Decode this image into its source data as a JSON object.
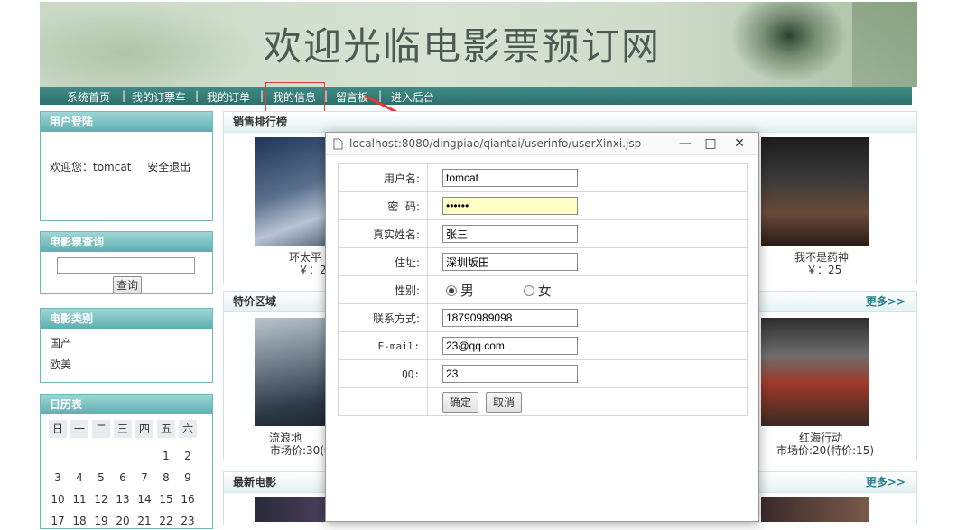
{
  "banner": {
    "title": "欢迎光临电影票预订网"
  },
  "nav": {
    "items": [
      "系统首页",
      "我的订票车",
      "我的订单",
      "我的信息",
      "留言板",
      "进入后台"
    ]
  },
  "login_panel": {
    "title": "用户登陆",
    "welcome": "欢迎您：tomcat",
    "logout": "安全退出"
  },
  "search_panel": {
    "title": "电影票查询",
    "button": "查询",
    "input_value": ""
  },
  "category_panel": {
    "title": "电影类别",
    "items": [
      "国产",
      "欧美"
    ]
  },
  "calendar_panel": {
    "title": "日历表",
    "weekdays": [
      "日",
      "一",
      "二",
      "三",
      "四",
      "五",
      "六"
    ],
    "rows": [
      [
        "",
        "",
        "",
        "",
        "",
        "1",
        "2"
      ],
      [
        "3",
        "4",
        "5",
        "6",
        "7",
        "8",
        "9"
      ],
      [
        "10",
        "11",
        "12",
        "13",
        "14",
        "15",
        "16"
      ],
      [
        "17",
        "18",
        "19",
        "20",
        "21",
        "22",
        "23"
      ]
    ]
  },
  "ranking": {
    "title": "销售排行榜",
    "left": {
      "name": "环太平",
      "price": "￥：2"
    },
    "right": {
      "name": "我不是药神",
      "price": "￥：25"
    }
  },
  "special": {
    "title": "特价区域",
    "more": "更多>>",
    "left": {
      "name": "流浪地",
      "price": "市场价:30(特"
    },
    "right": {
      "name": "红海行动",
      "price_market": "市场价:20",
      "price_special": "(特价:15)"
    }
  },
  "latest": {
    "title": "最新电影",
    "more": "更多>>"
  },
  "popup": {
    "url": "localhost:8080/dingpiao/qiantai/userinfo/userXinxi.jsp",
    "fields": [
      {
        "label": "用户名:",
        "value": "tomcat"
      },
      {
        "label": "密  码:",
        "value": "••••••"
      },
      {
        "label": "真实姓名:",
        "value": "张三"
      },
      {
        "label": "住址:",
        "value": "深圳坂田"
      }
    ],
    "gender": {
      "label": "性别:",
      "male": "男",
      "female": "女",
      "selected": "男"
    },
    "fields2": [
      {
        "label": "联系方式:",
        "value": "18790989098"
      },
      {
        "label": "E-mail:",
        "value": "23@qq.com"
      },
      {
        "label": "QQ:",
        "value": "23"
      }
    ],
    "buttons": {
      "ok": "确定",
      "cancel": "取消"
    }
  },
  "colors": {
    "nav_bg": "#2f6f6a",
    "panel_head": "#5eaeb0",
    "highlight": "#e23a3a",
    "arrow": "#e23a3a"
  }
}
